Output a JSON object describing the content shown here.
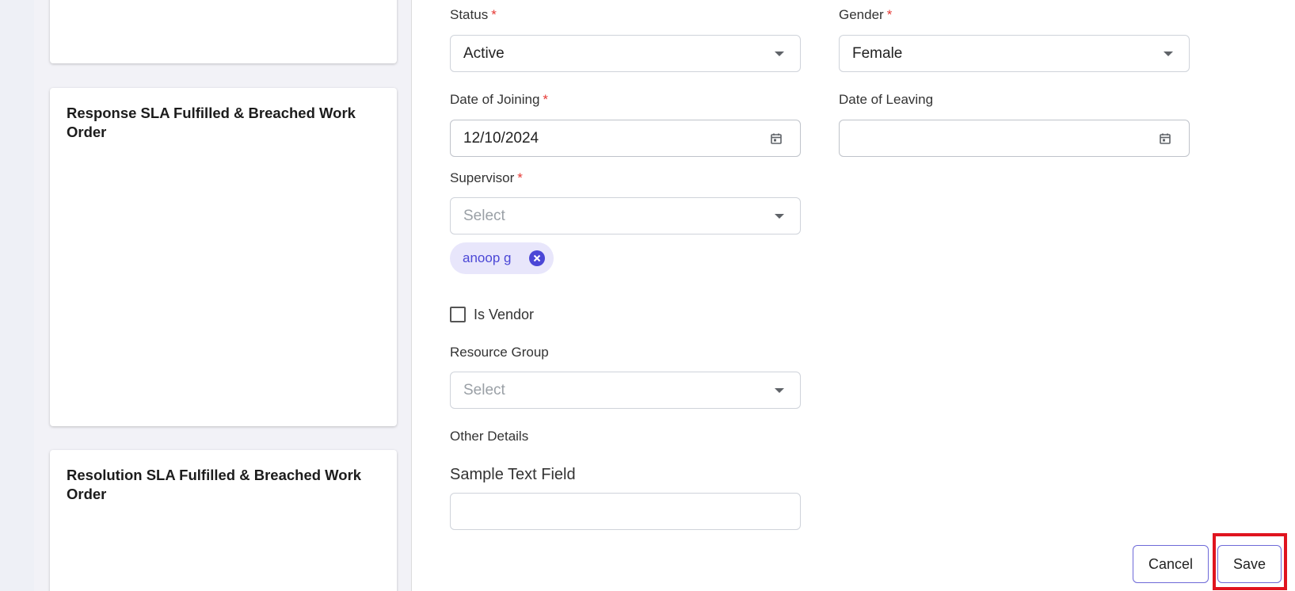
{
  "dashboard": {
    "cards": [
      {
        "title": ""
      },
      {
        "title": "Response SLA Fulfilled & Breached Work Order"
      },
      {
        "title": "Resolution SLA Fulfilled & Breached Work Order"
      }
    ]
  },
  "form": {
    "status": {
      "label": "Status",
      "required_mark": "*",
      "value": "Active"
    },
    "gender": {
      "label": "Gender",
      "required_mark": "*",
      "value": "Female"
    },
    "date_of_joining": {
      "label": "Date of Joining",
      "required_mark": "*",
      "value": "12/10/2024"
    },
    "date_of_leaving": {
      "label": "Date of Leaving",
      "value": ""
    },
    "supervisor": {
      "label": "Supervisor",
      "required_mark": "*",
      "placeholder": "Select",
      "chips": [
        "anoop g"
      ]
    },
    "is_vendor": {
      "label": "Is Vendor",
      "checked": false
    },
    "resource_group": {
      "label": "Resource Group",
      "placeholder": "Select"
    },
    "other_details": {
      "heading": "Other Details"
    },
    "sample_text_field": {
      "label": "Sample Text Field",
      "value": ""
    }
  },
  "actions": {
    "cancel_label": "Cancel",
    "save_label": "Save"
  },
  "colors": {
    "accent": "#4b47d6",
    "required": "#e53935",
    "highlight": "#e0141f",
    "chip_bg": "#e8e6fb"
  }
}
